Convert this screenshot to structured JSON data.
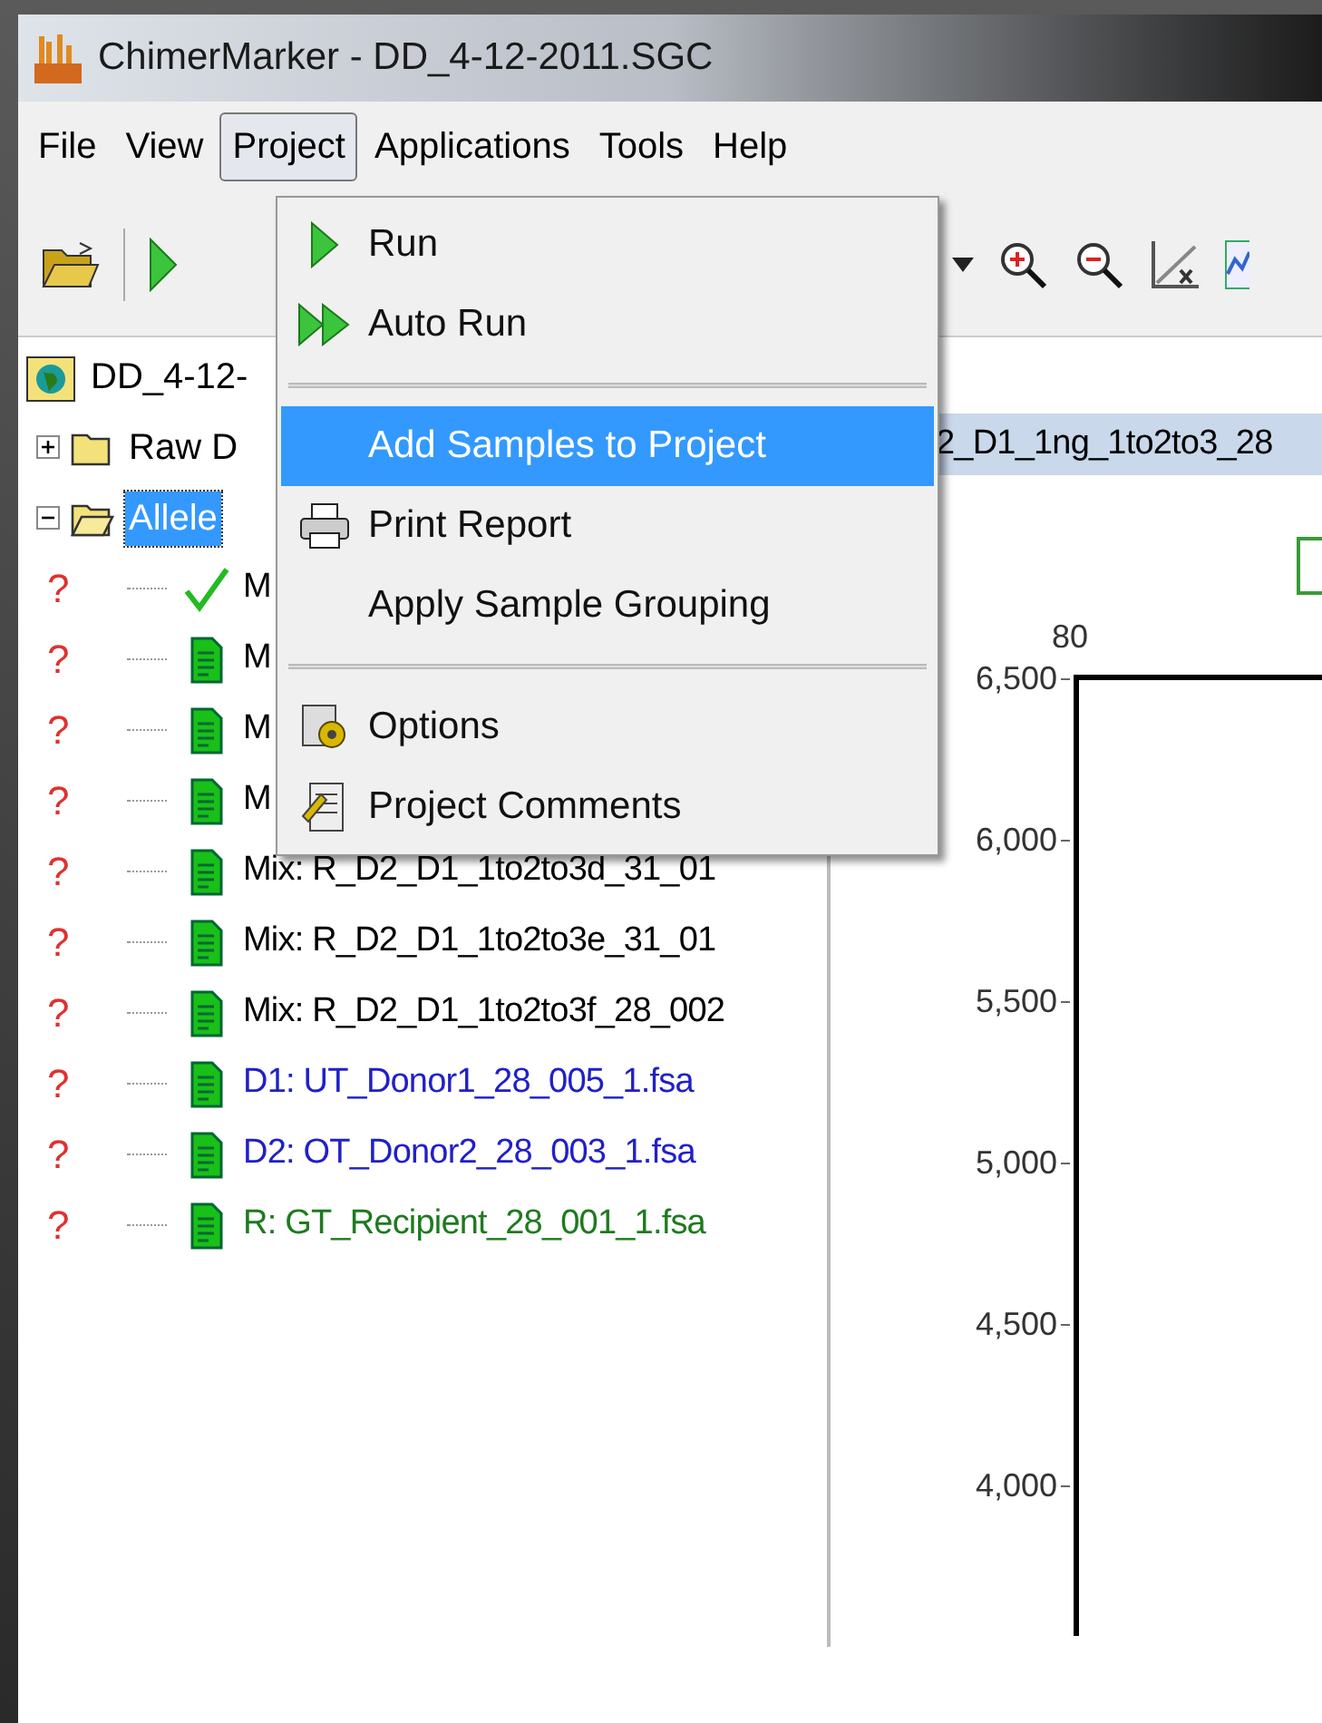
{
  "window": {
    "title": "ChimerMarker - DD_4-12-2011.SGC"
  },
  "menu_bar": [
    {
      "label": "File",
      "selected": false
    },
    {
      "label": "View",
      "selected": false
    },
    {
      "label": "Project",
      "selected": true
    },
    {
      "label": "Applications",
      "selected": false
    },
    {
      "label": "Tools",
      "selected": false
    },
    {
      "label": "Help",
      "selected": false
    }
  ],
  "project_menu": [
    {
      "kind": "item",
      "label": "Run",
      "selected": false
    },
    {
      "kind": "item",
      "label": "Auto Run",
      "selected": false
    },
    {
      "kind": "separator"
    },
    {
      "kind": "item",
      "label": "Add Samples to Project",
      "selected": true
    },
    {
      "kind": "item",
      "label": "Print Report",
      "selected": false
    },
    {
      "kind": "item",
      "label": "Apply Sample Grouping",
      "selected": false
    },
    {
      "kind": "separator"
    },
    {
      "kind": "item",
      "label": "Options",
      "selected": false
    },
    {
      "kind": "item",
      "label": "Project Comments",
      "selected": false
    }
  ],
  "tree": {
    "label": "DD_4-12-",
    "children": [
      {
        "label": "Raw D",
        "expanded": false,
        "selected": false
      },
      {
        "label": "Allele",
        "expanded": true,
        "selected": true,
        "children": [
          {
            "status": "?",
            "kind": "check",
            "label": "M",
            "color": "#000000"
          },
          {
            "status": "?",
            "kind": "file",
            "label": "M",
            "color": "#000000"
          },
          {
            "status": "?",
            "kind": "file",
            "label": "M",
            "color": "#000000"
          },
          {
            "status": "?",
            "kind": "file",
            "label": "M",
            "color": "#000000"
          },
          {
            "status": "?",
            "kind": "file",
            "label": "Mix: R_D2_D1_1to2to3d_31_01",
            "color": "#000000"
          },
          {
            "status": "?",
            "kind": "file",
            "label": "Mix: R_D2_D1_1to2to3e_31_01",
            "color": "#000000"
          },
          {
            "status": "?",
            "kind": "file",
            "label": "Mix: R_D2_D1_1to2to3f_28_002",
            "color": "#000000"
          },
          {
            "status": "?",
            "kind": "file",
            "label": "D1: UT_Donor1_28_005_1.fsa",
            "color": "#2020c8"
          },
          {
            "status": "?",
            "kind": "file",
            "label": "D2: OT_Donor2_28_003_1.fsa",
            "color": "#2020c8"
          },
          {
            "status": "?",
            "kind": "file",
            "label": "R: GT_Recipient_28_001_1.fsa",
            "color": "#1f7a1f"
          }
        ]
      }
    ]
  },
  "sample_tab": {
    "label": "2_D1_1ng_1to2to3_28"
  },
  "plot": {
    "x_labels": [
      "80"
    ],
    "y_labels": [
      "6,500",
      "6,000",
      "5,500",
      "5,000",
      "4,500",
      "4,000"
    ]
  }
}
